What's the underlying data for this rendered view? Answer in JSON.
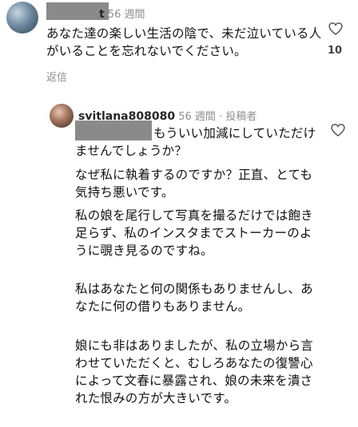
{
  "comment1": {
    "username_suffix": "t",
    "time": "56 週間",
    "text": "あなた達の楽しい生活の陰で、未だ泣いている人がいることを忘れないでください。",
    "likes": "10",
    "reply_label": "返信"
  },
  "comment2": {
    "username": "svitlana808080",
    "time": "56 週間",
    "separator": "·",
    "author_badge": "投稿者",
    "paragraphs": [
      "もういい加減にしていただけませんでしょうか？",
      "なぜ私に執着するのですか？正直、とても気持ち悪いです。",
      "私の娘を尾行して写真を撮るだけでは飽き足らず、私のインスタまでストーカーのように覗き見るのですね。",
      "私はあなたと何の関係もありませんし、あなたに何の借りもありません。",
      "娘にも非はありましたが、私の立場から言わせていただくと、むしろあなたの復讐心によって文春に暴露され、娘の未来を潰された恨みの方が大きいです。"
    ]
  },
  "icons": {
    "like": "heart-outline-icon"
  }
}
